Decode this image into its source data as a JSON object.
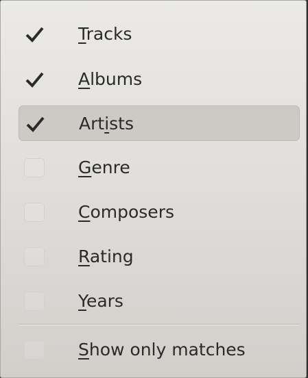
{
  "menu": {
    "items": [
      {
        "id": "tracks",
        "pre": "",
        "mnemonic": "T",
        "post": "racks",
        "checked": true
      },
      {
        "id": "albums",
        "pre": "",
        "mnemonic": "A",
        "post": "lbums",
        "checked": true
      },
      {
        "id": "artists",
        "pre": "Art",
        "mnemonic": "i",
        "post": "sts",
        "checked": true,
        "highlighted": true
      },
      {
        "id": "genre",
        "pre": "",
        "mnemonic": "G",
        "post": "enre",
        "checked": false
      },
      {
        "id": "composers",
        "pre": "",
        "mnemonic": "C",
        "post": "omposers",
        "checked": false
      },
      {
        "id": "rating",
        "pre": "",
        "mnemonic": "R",
        "post": "ating",
        "checked": false
      },
      {
        "id": "years",
        "pre": "",
        "mnemonic": "Y",
        "post": "ears",
        "checked": false
      }
    ],
    "extra_item": {
      "id": "show-only-matches",
      "pre": "",
      "mnemonic": "S",
      "post": "how only matches",
      "checked": false
    }
  },
  "colors": {
    "check_mark": "#2b2b2b",
    "highlight": "#cdcac6",
    "text": "#2a2a2a"
  },
  "icons": {
    "checked": "check-icon"
  }
}
